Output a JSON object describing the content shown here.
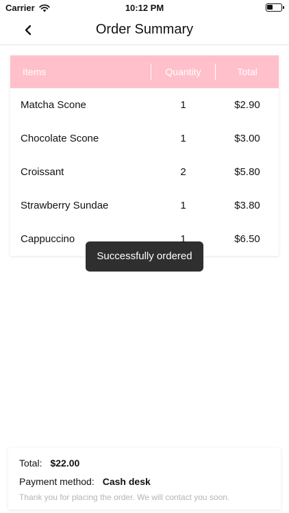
{
  "status_bar": {
    "carrier": "Carrier",
    "time": "10:12 PM"
  },
  "nav": {
    "title": "Order Summary"
  },
  "table": {
    "headers": [
      "Items",
      "Quantity",
      "Total"
    ],
    "rows": [
      {
        "name": "Matcha Scone",
        "qty": "1",
        "total": "$2.90"
      },
      {
        "name": "Chocolate Scone",
        "qty": "1",
        "total": "$3.00"
      },
      {
        "name": "Croissant",
        "qty": "2",
        "total": "$5.80"
      },
      {
        "name": "Strawberry Sundae",
        "qty": "1",
        "total": "$3.80"
      },
      {
        "name": "Cappuccino",
        "qty": "1",
        "total": "$6.50"
      }
    ]
  },
  "toast": {
    "message": "Successfully ordered"
  },
  "summary": {
    "total_label": "Total:",
    "total_value": "$22.00",
    "payment_label": "Payment method:",
    "payment_value": "Cash desk",
    "note": "Thank you for placing the order. We will contact you soon."
  },
  "colors": {
    "header_bg": "#ffc0cb",
    "toast_bg": "#222222",
    "note_text": "#b4b4b4"
  }
}
